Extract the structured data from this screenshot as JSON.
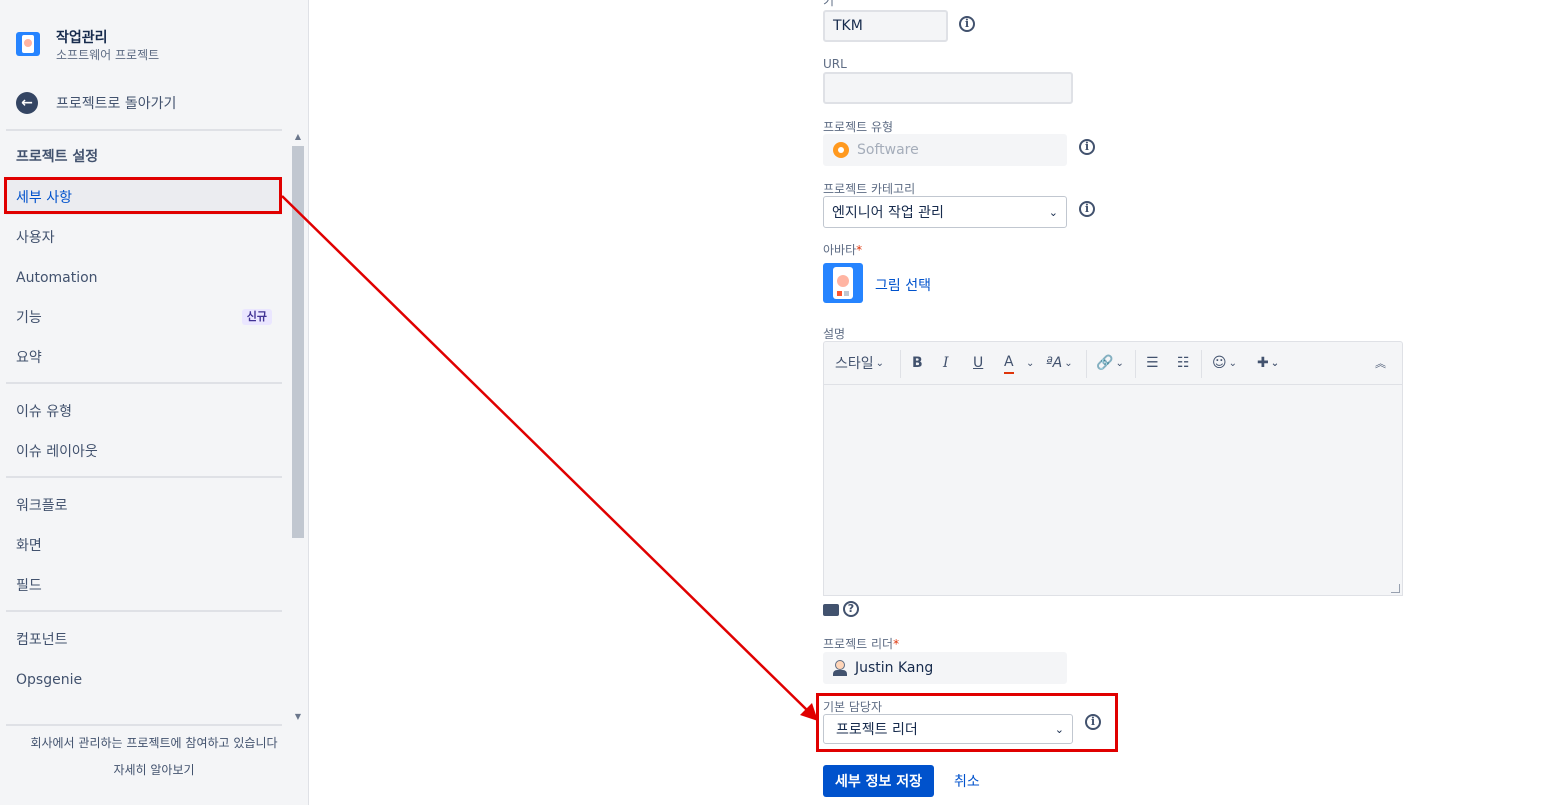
{
  "sidebar": {
    "project_name": "작업관리",
    "project_type": "소프트웨어 프로젝트",
    "back_label": "프로젝트로 돌아가기",
    "heading": "프로젝트 설정",
    "items": [
      {
        "label": "세부 사항"
      },
      {
        "label": "사용자"
      },
      {
        "label": "Automation"
      },
      {
        "label": "기능",
        "badge": "신규"
      },
      {
        "label": "요약"
      },
      {
        "label": "이슈 유형"
      },
      {
        "label": "이슈 레이아웃"
      },
      {
        "label": "워크플로"
      },
      {
        "label": "화면"
      },
      {
        "label": "필드"
      },
      {
        "label": "컴포넌트"
      },
      {
        "label": "Opsgenie"
      }
    ],
    "footer_text": "회사에서 관리하는 프로젝트에 참여하고 있습니다",
    "footer_link": "자세히 알아보기"
  },
  "form": {
    "key": {
      "label": "키",
      "value": "TKM"
    },
    "url": {
      "label": "URL",
      "value": ""
    },
    "project_type": {
      "label": "프로젝트 유형",
      "value": "Software"
    },
    "category": {
      "label": "프로젝트 카테고리",
      "value": "엔지니어 작업 관리"
    },
    "avatar": {
      "label": "아바타",
      "required": "*",
      "action": "그림 선택"
    },
    "description": {
      "label": "설명",
      "toolbar": {
        "style": "스타일",
        "bold": "B",
        "italic": "I",
        "underline": "U",
        "text_color": "A",
        "text_effects": "ªA"
      }
    },
    "project_lead": {
      "label": "프로젝트 리더",
      "required": "*",
      "value": "Justin Kang"
    },
    "default_assignee": {
      "label": "기본 담당자",
      "value": "프로젝트 리더"
    },
    "save_button": "세부 정보 저장",
    "cancel_button": "취소"
  },
  "colors": {
    "primary": "#0052cc",
    "annotation": "#e00000",
    "required": "#de350b"
  }
}
